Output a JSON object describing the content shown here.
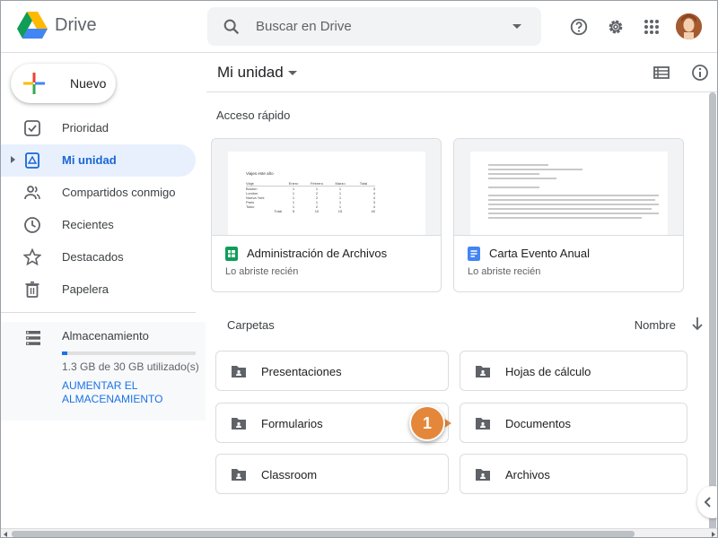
{
  "header": {
    "app_name": "Drive",
    "search_placeholder": "Buscar en Drive",
    "icons": [
      "drive-logo-icon",
      "search-icon",
      "help-icon",
      "settings-icon",
      "apps-grid-icon"
    ]
  },
  "sidebar": {
    "new_label": "Nuevo",
    "items": [
      {
        "label": "Prioridad",
        "icon": "priority-check-icon",
        "active": false
      },
      {
        "label": "Mi unidad",
        "icon": "my-drive-icon",
        "active": true
      },
      {
        "label": "Compartidos conmigo",
        "icon": "shared-people-icon",
        "active": false
      },
      {
        "label": "Recientes",
        "icon": "clock-icon",
        "active": false
      },
      {
        "label": "Destacados",
        "icon": "star-icon",
        "active": false
      },
      {
        "label": "Papelera",
        "icon": "trash-icon",
        "active": false
      }
    ],
    "storage": {
      "title": "Almacenamiento",
      "used_text": "1.3 GB de 30 GB utilizado(s)",
      "used_fraction": 0.043,
      "upgrade_link": "AUMENTAR EL ALMACENAMIENTO"
    }
  },
  "main": {
    "title": "Mi unidad",
    "quick_access_label": "Acceso rápido",
    "quick_access": [
      {
        "name": "Administración de Archivos",
        "subtitle": "Lo abriste recién",
        "type": "sheets",
        "type_color": "#0f9d58"
      },
      {
        "name": "Carta Evento Anual",
        "subtitle": "Lo abriste recién",
        "type": "docs",
        "type_color": "#4285f4"
      }
    ],
    "folders_label": "Carpetas",
    "sort_label": "Nombre",
    "folders": [
      {
        "name": "Presentaciones"
      },
      {
        "name": "Hojas de cálculo"
      },
      {
        "name": "Formularios"
      },
      {
        "name": "Documentos"
      },
      {
        "name": "Classroom"
      },
      {
        "name": "Archivos"
      }
    ],
    "callout_number": "1"
  },
  "thumb_sheet": {
    "title": "Viajes este año",
    "headers": [
      "Viaje",
      "Enero",
      "Febrero",
      "Marzo",
      "Total"
    ],
    "rows": [
      [
        "Boston",
        "1",
        "1",
        "1",
        "3"
      ],
      [
        "London",
        "1",
        "2",
        "1",
        "4"
      ],
      [
        "Nueva York",
        "1",
        "2",
        "1",
        "4"
      ],
      [
        "Paris",
        "1",
        "1",
        "1",
        "3"
      ],
      [
        "Tokio",
        "1",
        "2",
        "1",
        "4"
      ],
      [
        "Total",
        "5",
        "10",
        "15",
        "40"
      ]
    ]
  },
  "colors": {
    "accent": "#1a73e8",
    "active_bg": "#e8f0fe",
    "callout": "#e4873b",
    "folder_icon": "#5f6368"
  }
}
